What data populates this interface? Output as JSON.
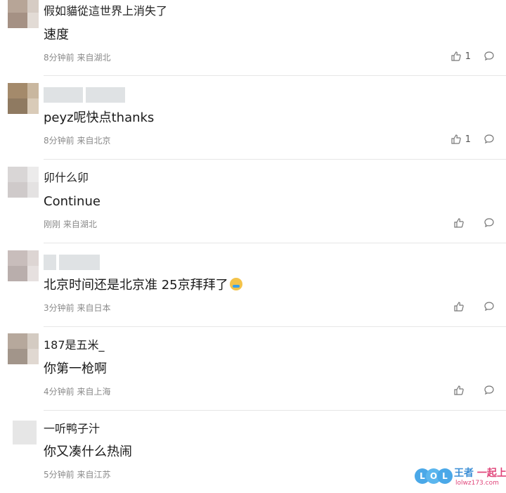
{
  "comments": [
    {
      "username": "假如貓從這世界上消失了",
      "text": "速度",
      "meta": "8分钟前 来自湖北",
      "likes": "1",
      "avatar_colors": [
        "#b7a597",
        "#d6ccc4",
        "#a59184",
        "#e2dbd5"
      ]
    },
    {
      "username": "",
      "text": "peyz呢快点thanks",
      "meta": "8分钟前 来自北京",
      "likes": "1",
      "avatar_colors": [
        "#a48a6b",
        "#c9b79f",
        "#8f7a61",
        "#d9cbb8"
      ]
    },
    {
      "username": "卯什么卯",
      "text": "Continue",
      "meta": "刚刚 来自湖北",
      "likes": "",
      "avatar_colors": [
        "#d9d6d6",
        "#ecebeb",
        "#cfcaca",
        "#e4e2e2"
      ]
    },
    {
      "username": "",
      "text": "北京时间还是北京准 25京拜拜了",
      "meta": "3分钟前 来自日本",
      "likes": "",
      "avatar_colors": [
        "#c8bdbb",
        "#ddd5d3",
        "#b9aeac",
        "#e6e0df"
      ]
    },
    {
      "username": "187是五米_",
      "text": "你第一枪啊",
      "meta": "4分钟前 来自上海",
      "likes": "",
      "avatar_colors": [
        "#b6a89c",
        "#d4cbc2",
        "#a2958a",
        "#e0d8d1"
      ]
    },
    {
      "username": "一听鸭子汁",
      "text": "你又凑什么热闹",
      "meta": "5分钟前 来自江苏",
      "likes": "",
      "avatar_colors": [
        "#e6e6e6",
        "#ececec",
        "#e1e1e1",
        "#eaeaea"
      ]
    }
  ],
  "watermark": {
    "letters": [
      "L",
      "O",
      "L"
    ],
    "brand": "王者",
    "brand_sub": "一起上",
    "url": "lolwz173.com"
  },
  "icons": {
    "like": "thumbs-up-icon",
    "reply": "comment-bubble-icon"
  },
  "colors": {
    "meta": "#8a8a8a",
    "divider": "#e6e6e6",
    "brand": "#3d8fd6"
  }
}
